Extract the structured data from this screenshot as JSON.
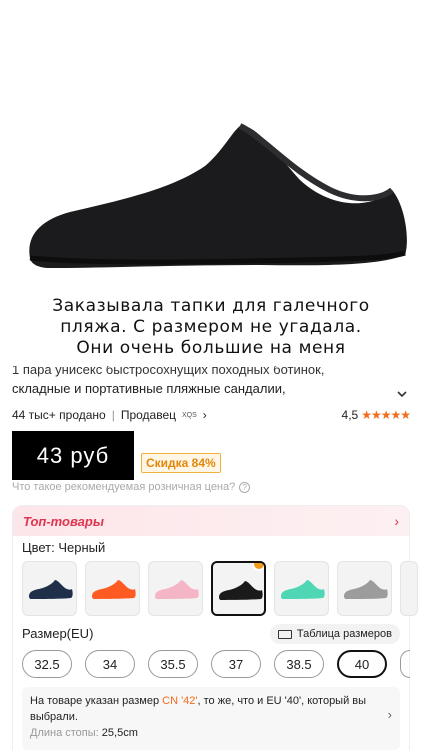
{
  "caption": {
    "line1": "Заказывала тапки для галечного",
    "line2": "пляжа. С размером не угадала.",
    "line3": "Они очень большие на меня"
  },
  "product": {
    "title_line1": "1 пара унисекс быстросохнущих походных ботинок,",
    "title_line2": "складные и портативные пляжные сандалии,",
    "sold": "44 тыс+ продано",
    "seller_label": "Продавец",
    "seller_name": "XQS",
    "rating": "4,5",
    "stars": "★★★★★"
  },
  "pricing": {
    "price": "43 руб",
    "discount": "Скидка 84%",
    "rrp_question": "Что такое рекомендуемая розничная цена?"
  },
  "top": {
    "label": "Топ-товары"
  },
  "color": {
    "label": "Цвет: Черный",
    "swatches": [
      {
        "color": "#1f2f4a",
        "name": "navy"
      },
      {
        "color": "#ff5a22",
        "name": "orange"
      },
      {
        "color": "#f4b6c6",
        "name": "pink"
      },
      {
        "color": "#1a1a1a",
        "name": "black"
      },
      {
        "color": "#4fd6b4",
        "name": "mint"
      },
      {
        "color": "#9c9c9c",
        "name": "gray"
      }
    ]
  },
  "size": {
    "label": "Размер(EU)",
    "table_label": "Таблица размеров",
    "options": [
      "32.5",
      "34",
      "35.5",
      "37",
      "38.5",
      "40"
    ],
    "selected": "40"
  },
  "note": {
    "prefix": "На товаре указан размер ",
    "cn_size": "CN '42'",
    "suffix": ", то же, что и EU '40', который вы выбрали.",
    "foot_label": "Длина стопы: ",
    "foot_value": "25,5cm"
  }
}
